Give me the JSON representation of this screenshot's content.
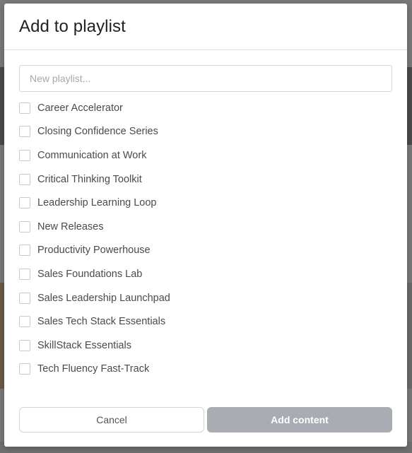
{
  "dialog": {
    "title": "Add to playlist",
    "new_playlist_placeholder": "New playlist...",
    "playlists": [
      {
        "label": "Career Accelerator",
        "checked": false
      },
      {
        "label": "Closing Confidence Series",
        "checked": false
      },
      {
        "label": "Communication at Work",
        "checked": false
      },
      {
        "label": "Critical Thinking Toolkit",
        "checked": false
      },
      {
        "label": "Leadership Learning Loop",
        "checked": false
      },
      {
        "label": "New Releases",
        "checked": false
      },
      {
        "label": "Productivity Powerhouse",
        "checked": false
      },
      {
        "label": "Sales Foundations Lab",
        "checked": false
      },
      {
        "label": "Sales Leadership Launchpad",
        "checked": false
      },
      {
        "label": "Sales Tech Stack Essentials",
        "checked": false
      },
      {
        "label": "SkillStack Essentials",
        "checked": false
      },
      {
        "label": "Tech Fluency Fast-Track",
        "checked": false
      }
    ],
    "cancel_label": "Cancel",
    "add_label": "Add content"
  },
  "colors": {
    "primary_disabled": "#a9adb3",
    "overlay": "#6b6b6b"
  }
}
